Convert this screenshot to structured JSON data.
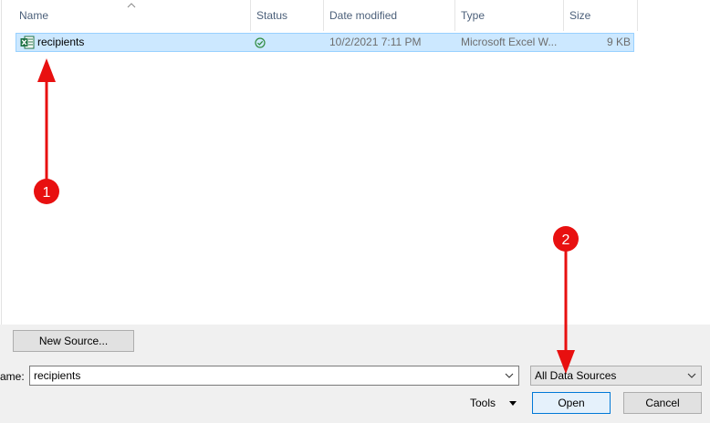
{
  "columns": {
    "name": "Name",
    "status": "Status",
    "date_modified": "Date modified",
    "type": "Type",
    "size": "Size"
  },
  "files": [
    {
      "name": "recipients",
      "status_icon": "synced-check-icon",
      "date_modified": "10/2/2021 7:11 PM",
      "type": "Microsoft Excel W...",
      "size": "9 KB",
      "file_icon": "excel-file-icon"
    }
  ],
  "buttons": {
    "new_source": "New Source...",
    "tools": "Tools",
    "open": "Open",
    "cancel": "Cancel"
  },
  "filename": {
    "label": "ame:",
    "value": "recipients"
  },
  "filetype": {
    "selected": "All Data Sources"
  },
  "annotations": [
    {
      "number": "1"
    },
    {
      "number": "2"
    }
  ],
  "colors": {
    "selection_bg": "#cce8ff",
    "selection_border": "#99d1ff",
    "header_text": "#4c607a",
    "accent_button_border": "#0078d7",
    "annotation_red": "#e81010",
    "status_green": "#2e8b3d",
    "excel_green": "#1f7244"
  }
}
